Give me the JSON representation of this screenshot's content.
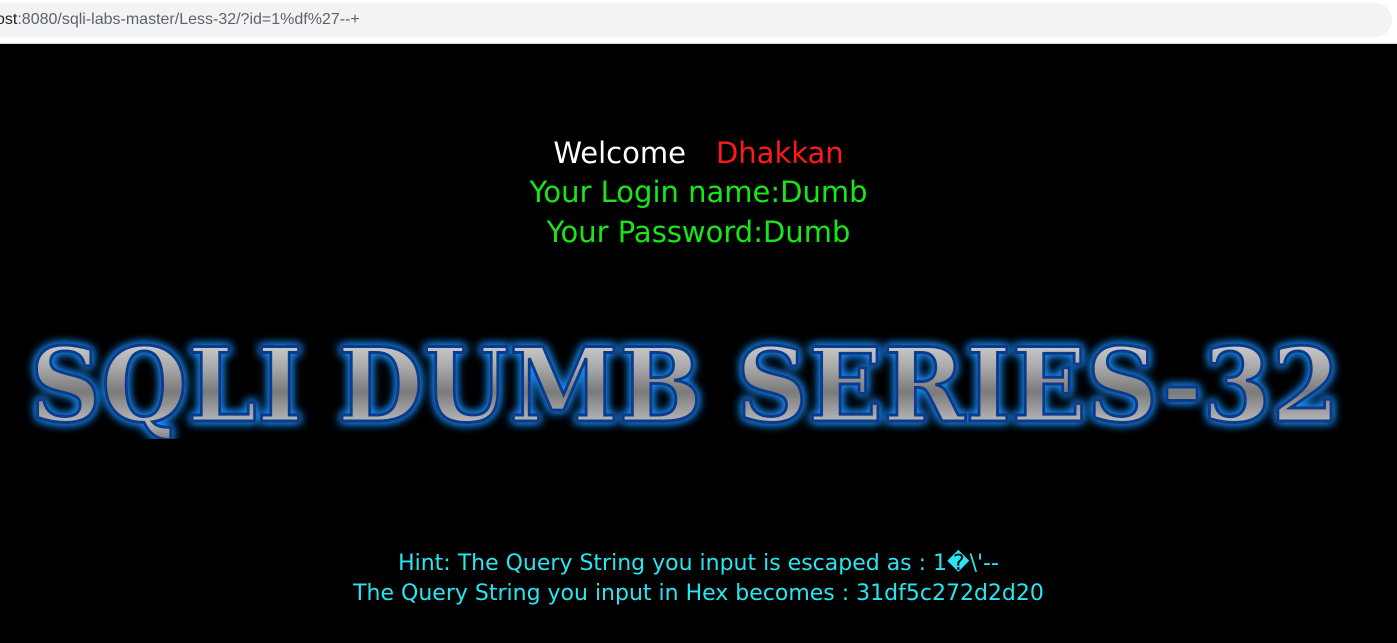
{
  "browser": {
    "url_host": "ost",
    "url_rest": ":8080/sqli-labs-master/Less-32/?id=1%df%27--+"
  },
  "welcome": {
    "greeting": "Welcome",
    "name": "Dhakkan"
  },
  "result": {
    "login_name": "Your Login name:Dumb",
    "password": "Your Password:Dumb"
  },
  "banner": {
    "text": "SQLI DUMB SERIES-32"
  },
  "hint": {
    "escaped": "Hint: The Query String you input is escaped as : 1�\\'--",
    "hex": "The Query String you input in Hex becomes : 31df5c272d2d20"
  },
  "colors": {
    "background": "#000000",
    "welcome_name": "#ff1a1a",
    "result_text": "#19e619",
    "hint_text": "#28e6f0",
    "banner_glow": "#1e90ff"
  }
}
